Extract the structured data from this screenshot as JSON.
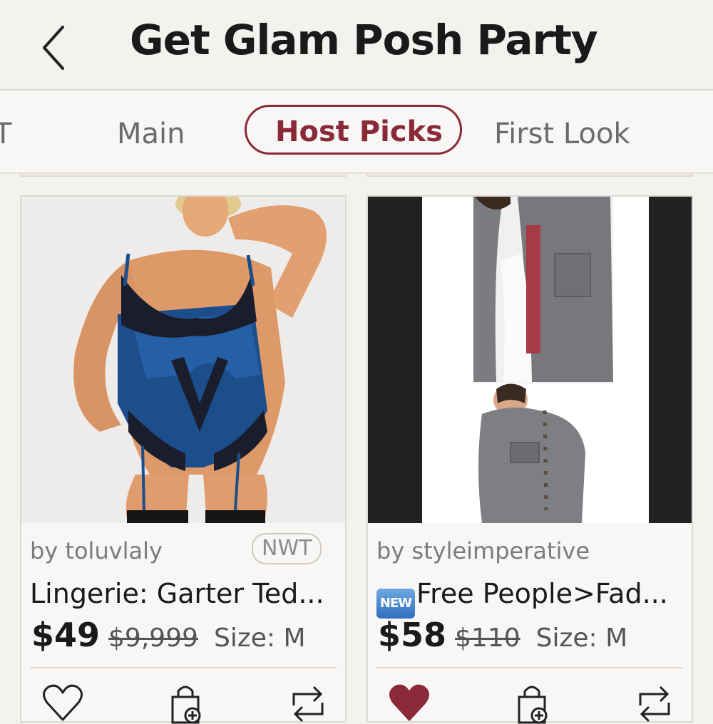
{
  "header": {
    "title": "Get Glam Posh Party"
  },
  "tabs": [
    {
      "label": "T"
    },
    {
      "label": "Main"
    },
    {
      "label": "Host Picks"
    },
    {
      "label": "First Look"
    }
  ],
  "colors": {
    "accent": "#8a2a38",
    "background": "#f4f2ef"
  },
  "listings": [
    {
      "seller": "by toluvlaly",
      "badge": "NWT",
      "title": "Lingerie: Garter Ted...",
      "price": "$49",
      "original_price": "$9,999",
      "size": "Size: M",
      "liked": false
    },
    {
      "seller": "by styleimperative",
      "new_icon": "NEW",
      "title": "Free People>Fad...",
      "price": "$58",
      "original_price": "$110",
      "size": "Size: M",
      "liked": true
    }
  ]
}
